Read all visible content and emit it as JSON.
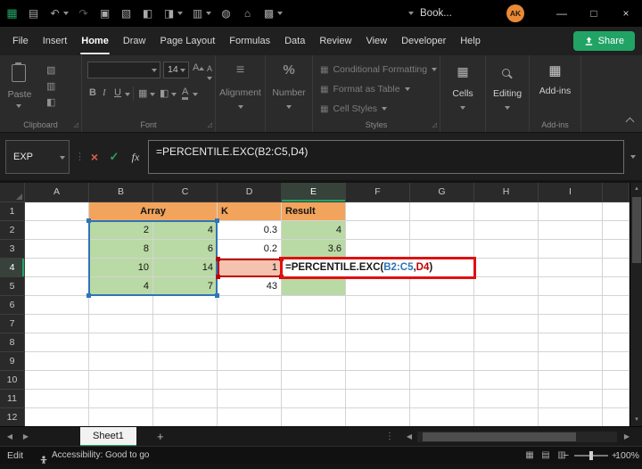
{
  "colors": {
    "accent_green": "#21A366",
    "orange_fill": "#F2A45C",
    "green_fill": "#B9D9A5",
    "pink_fill": "#F4C2AE",
    "ref_blue": "#2E75B6",
    "ref_red": "#C00000",
    "annotation_red": "#E01010",
    "grid_line": "#D4D4D4"
  },
  "icons": {
    "app": "▦",
    "save": "▤",
    "undo": "↶",
    "redo": "↷",
    "clipboard": "▣",
    "cut": "▧",
    "painter": "◧",
    "table": "▩",
    "fill": "◨",
    "chart": "▥",
    "globe": "◍",
    "home": "⌂",
    "minimize": "—",
    "maximize": "□",
    "close": "×",
    "cancel": "×",
    "check": "✓",
    "fx": "fx",
    "dots_v": "⋮",
    "nav_left": "◀",
    "nav_right": "▶",
    "up": "▴",
    "down": "▾",
    "plus": "+",
    "minus": "−",
    "percent": "%",
    "align_lines": "≡",
    "borders": "▦",
    "fill_bucket": "◧",
    "font_color": "A",
    "bold": "B",
    "italic": "I",
    "underline": "U",
    "font_inc": "A",
    "font_dec": "A",
    "cells": "▦",
    "addins": "▦",
    "styles_item": "▦",
    "copy": "▥",
    "view_normal": "▦",
    "view_layout": "▤",
    "view_break": "▥"
  },
  "titlebar": {
    "title": "Book...",
    "avatar": "AK"
  },
  "tabs": {
    "items": [
      "File",
      "Insert",
      "Home",
      "Draw",
      "Page Layout",
      "Formulas",
      "Data",
      "Review",
      "View",
      "Developer",
      "Help"
    ],
    "active": "Home",
    "share": "Share"
  },
  "ribbon": {
    "paste": "Paste",
    "clipboard_label": "Clipboard",
    "font_label": "Font",
    "font_size": "14",
    "alignment": "Alignment",
    "number": "Number",
    "conditional_formatting": "Conditional Formatting",
    "format_as_table": "Format as Table",
    "cell_styles": "Cell Styles",
    "styles_label": "Styles",
    "cells": "Cells",
    "editing": "Editing",
    "addins": "Add-ins",
    "addins_label": "Add-ins"
  },
  "formula_bar": {
    "name_box": "EXP",
    "formula": "=PERCENTILE.EXC(B2:C5,D4)",
    "parts": {
      "prefix": "=PERCENTILE.EXC(",
      "ref1": "B2:C5",
      "sep": ",",
      "ref2": "D4",
      "close": ")"
    }
  },
  "grid": {
    "col_headers": [
      "A",
      "B",
      "C",
      "D",
      "E",
      "F",
      "G",
      "H",
      "I"
    ],
    "row_count": 12,
    "active_col": "E",
    "active_row": 4,
    "merged": {
      "range": "B1:C1",
      "value": "Array"
    },
    "cells": [
      {
        "ref": "D1",
        "value": "K",
        "fill": "orange",
        "align": "left",
        "bold": true
      },
      {
        "ref": "E1",
        "value": "Result",
        "fill": "orange",
        "align": "left",
        "bold": true
      },
      {
        "ref": "B2",
        "value": "2",
        "fill": "green",
        "align": "right"
      },
      {
        "ref": "C2",
        "value": "4",
        "fill": "green",
        "align": "right"
      },
      {
        "ref": "D2",
        "value": "0.3",
        "fill": "none",
        "align": "right"
      },
      {
        "ref": "E2",
        "value": "4",
        "fill": "green",
        "align": "right"
      },
      {
        "ref": "B3",
        "value": "8",
        "fill": "green",
        "align": "right"
      },
      {
        "ref": "C3",
        "value": "6",
        "fill": "green",
        "align": "right"
      },
      {
        "ref": "D3",
        "value": "0.2",
        "fill": "none",
        "align": "right"
      },
      {
        "ref": "E3",
        "value": "3.6",
        "fill": "green",
        "align": "right"
      },
      {
        "ref": "B4",
        "value": "10",
        "fill": "green",
        "align": "right"
      },
      {
        "ref": "C4",
        "value": "14",
        "fill": "green",
        "align": "right"
      },
      {
        "ref": "D4",
        "value": "1",
        "fill": "pink",
        "align": "right"
      },
      {
        "ref": "B5",
        "value": "4",
        "fill": "green",
        "align": "right"
      },
      {
        "ref": "C5",
        "value": "7",
        "fill": "green",
        "align": "right"
      },
      {
        "ref": "D5",
        "value": "43",
        "fill": "none",
        "align": "right"
      },
      {
        "ref": "E5",
        "value": "",
        "fill": "green",
        "align": "right"
      }
    ],
    "selection_range": "B2:C5",
    "ref_cell": "D4",
    "annotation_range": "E4:G4"
  },
  "sheet_bar": {
    "active_tab": "Sheet1"
  },
  "status_bar": {
    "mode": "Edit",
    "accessibility": "Accessibility: Good to go",
    "zoom": "100%"
  }
}
